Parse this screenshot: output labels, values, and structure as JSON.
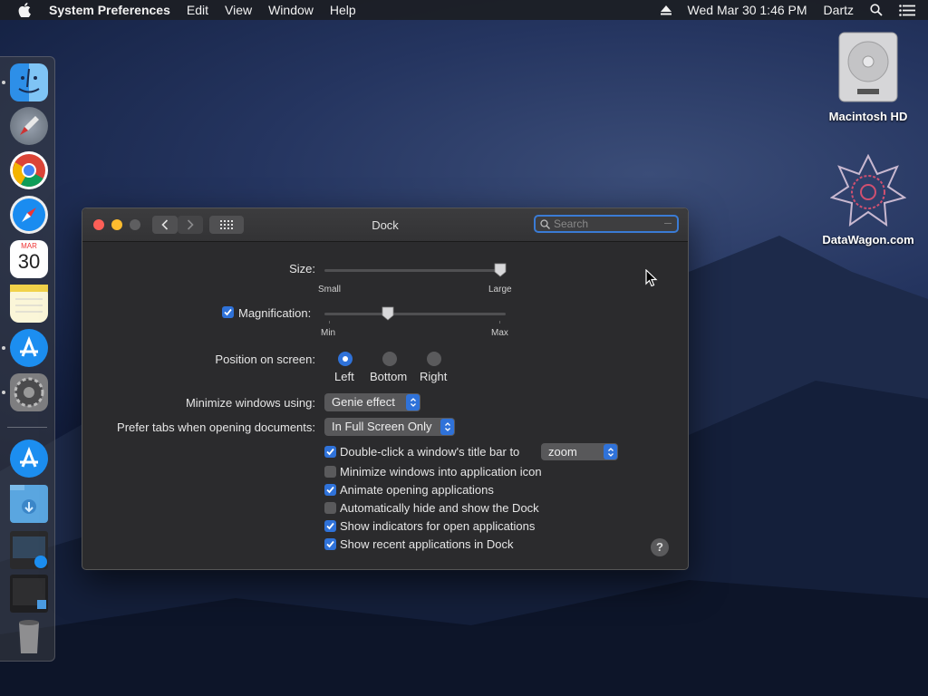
{
  "menubar": {
    "app_name": "System Preferences",
    "items": [
      "Edit",
      "View",
      "Window",
      "Help"
    ],
    "datetime": "Wed Mar 30  1:46 PM",
    "user": "Dartz"
  },
  "dock": {
    "items": [
      "Finder",
      "Launchpad",
      "Chrome",
      "Safari",
      "Calendar",
      "Notes",
      "App Store",
      "System Preferences",
      "App Store Downloads",
      "Downloads",
      "Screenshot 1",
      "Screenshot 2",
      "Trash"
    ],
    "calendar_month": "MAR",
    "calendar_day": "30"
  },
  "desktop": {
    "icons": [
      {
        "label": "Macintosh HD"
      },
      {
        "label": "DataWagon.com"
      }
    ]
  },
  "window": {
    "title": "Dock",
    "search_placeholder": "Search",
    "size": {
      "label": "Size:",
      "min_label": "Small",
      "max_label": "Large",
      "value": 0.97
    },
    "magnification": {
      "label": "Magnification:",
      "checked": true,
      "min_label": "Min",
      "max_label": "Max",
      "value": 0.35
    },
    "position": {
      "label": "Position on screen:",
      "options": [
        "Left",
        "Bottom",
        "Right"
      ],
      "selected": "Left"
    },
    "minimize_using": {
      "label": "Minimize windows using:",
      "value": "Genie effect"
    },
    "prefer_tabs": {
      "label": "Prefer tabs when opening documents:",
      "value": "In Full Screen Only"
    },
    "checkboxes": [
      {
        "label": "Double-click a window's title bar to",
        "checked": true,
        "popup": "zoom"
      },
      {
        "label": "Minimize windows into application icon",
        "checked": false
      },
      {
        "label": "Animate opening applications",
        "checked": true
      },
      {
        "label": "Automatically hide and show the Dock",
        "checked": false
      },
      {
        "label": "Show indicators for open applications",
        "checked": true
      },
      {
        "label": "Show recent applications in Dock",
        "checked": true
      }
    ],
    "help": "?"
  },
  "colors": {
    "accent": "#2f72d9",
    "window_bg": "#2b2b2d",
    "close": "#fc5f57",
    "minimize": "#fdbc2e",
    "zoom_disabled": "#5e5e60"
  }
}
